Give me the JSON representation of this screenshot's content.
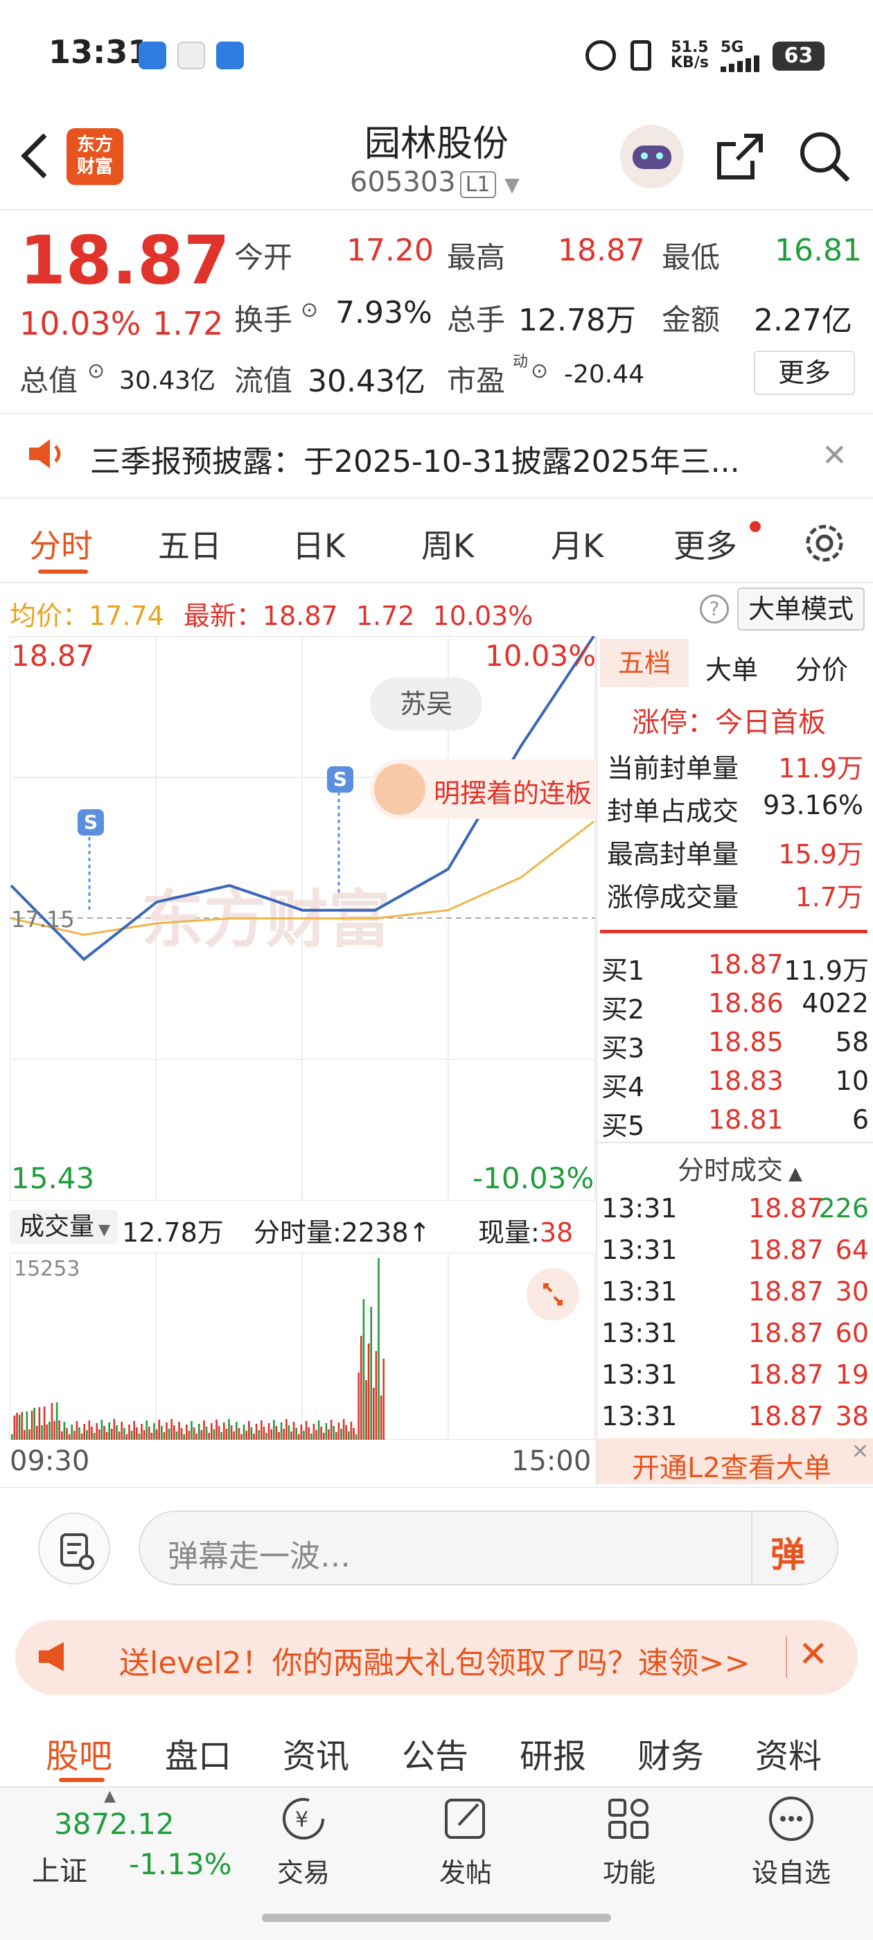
{
  "status_bar": {
    "time": "13:31",
    "net_speed": "51.5",
    "net_unit": "KB/s",
    "network": "5G",
    "battery": "63"
  },
  "header": {
    "back_icon": "chevron-left-icon",
    "brand_line1": "东方",
    "brand_line2": "财富",
    "stock_name": "园林股份",
    "stock_code": "605303",
    "level_badge": "L1",
    "share_icon": "share-icon",
    "search_icon": "search-icon"
  },
  "quote": {
    "price": "18.87",
    "change_pct": "10.03%",
    "change_amt": "1.72",
    "open_label": "今开",
    "open_value": "17.20",
    "high_label": "最高",
    "high_value": "18.87",
    "low_label": "最低",
    "low_value": "16.81",
    "turnover_label": "换手",
    "turnover_value": "7.93%",
    "volume_label": "总手",
    "volume_value": "12.78万",
    "amount_label": "金额",
    "amount_value": "2.27亿",
    "mktcap_label": "总值",
    "mktcap_value": "30.43亿",
    "float_label": "流值",
    "float_value": "30.43亿",
    "pe_label": "市盈",
    "pe_sup": "动",
    "pe_value": "-20.44",
    "more_button": "更多"
  },
  "notice": {
    "text": "三季报预披露：于2025-10-31披露2025年三..."
  },
  "chart_tabs": [
    "分时",
    "五日",
    "日K",
    "周K",
    "月K",
    "更多"
  ],
  "chart_header": {
    "avg_label": "均价：",
    "avg_value": "17.74",
    "latest_label": "最新：",
    "latest_value": "18.87",
    "latest_change": "1.72",
    "latest_pct": "10.03%",
    "mode_button": "大单模式"
  },
  "chart_labels": {
    "top_price": "18.87",
    "top_pct": "10.03%",
    "mid_price": "17.15",
    "bottom_price": "15.43",
    "bottom_pct": "-10.03%",
    "watermark": "东方财富",
    "bubble": "苏吴",
    "bubble2": "明摆着的连板",
    "s_marker": "S"
  },
  "volume_bar": {
    "selector": "成交量",
    "total": "12.78万",
    "minute_label": "分时量:2238",
    "now_label": "现量:",
    "now_value": "38",
    "max_label": "15253",
    "start_time": "09:30",
    "end_time": "15:00"
  },
  "chart_data": {
    "type": "line",
    "x": [
      "09:30",
      "10:00",
      "10:30",
      "11:00",
      "11:30/13:00",
      "13:30",
      "14:00",
      "14:30",
      "15:00"
    ],
    "ylim": [
      15.43,
      18.87
    ],
    "series": [
      {
        "values": [
          17.35,
          16.9,
          17.25,
          17.35,
          17.2,
          17.2,
          17.45,
          18.2,
          18.87
        ]
      },
      {
        "values": [
          17.15,
          17.05,
          17.12,
          17.15,
          17.15,
          17.15,
          17.2,
          17.4,
          17.74
        ]
      }
    ]
  },
  "right_panel": {
    "tabs": [
      "五档",
      "大单",
      "分价"
    ],
    "limit_title": "涨停：今日首板",
    "stats": [
      {
        "label": "当前封单量",
        "value": "11.9万"
      },
      {
        "label": "封单占成交",
        "value": "93.16%"
      },
      {
        "label": "最高封单量",
        "value": "15.9万"
      },
      {
        "label": "涨停成交量",
        "value": "1.7万"
      }
    ],
    "bids": [
      {
        "label": "买1",
        "price": "18.87",
        "qty": "11.9万"
      },
      {
        "label": "买2",
        "price": "18.86",
        "qty": "4022"
      },
      {
        "label": "买3",
        "price": "18.85",
        "qty": "58"
      },
      {
        "label": "买4",
        "price": "18.83",
        "qty": "10"
      },
      {
        "label": "买5",
        "price": "18.81",
        "qty": "6"
      }
    ],
    "trades_title": "分时成交",
    "trades": [
      {
        "time": "13:31",
        "price": "18.87",
        "qty": "226"
      },
      {
        "time": "13:31",
        "price": "18.87",
        "qty": "64"
      },
      {
        "time": "13:31",
        "price": "18.87",
        "qty": "30"
      },
      {
        "time": "13:31",
        "price": "18.87",
        "qty": "60"
      },
      {
        "time": "13:31",
        "price": "18.87",
        "qty": "19"
      },
      {
        "time": "13:31",
        "price": "18.87",
        "qty": "38"
      }
    ],
    "l2_banner": "开通L2查看大单"
  },
  "danmu": {
    "placeholder": "弹幕走一波…",
    "send_label": "弹"
  },
  "promo": {
    "text": "送level2！你的两融大礼包领取了吗？速领>>"
  },
  "bottom_tabs": [
    "股吧",
    "盘口",
    "资讯",
    "公告",
    "研报",
    "财务",
    "资料"
  ],
  "dock": {
    "index_value": "3872.12",
    "index_name": "上证",
    "index_change": "-1.13%",
    "items": [
      {
        "label": "交易",
        "icon": "trade-icon"
      },
      {
        "label": "发帖",
        "icon": "edit-icon"
      },
      {
        "label": "功能",
        "icon": "grid-icon"
      },
      {
        "label": "设自选",
        "icon": "more-icon"
      }
    ]
  },
  "colors": {
    "up": "#e0332b",
    "down": "#1f9d3c",
    "accent": "#e8541e",
    "price_line": "#3b67b8",
    "avg_line": "#f0b449"
  }
}
